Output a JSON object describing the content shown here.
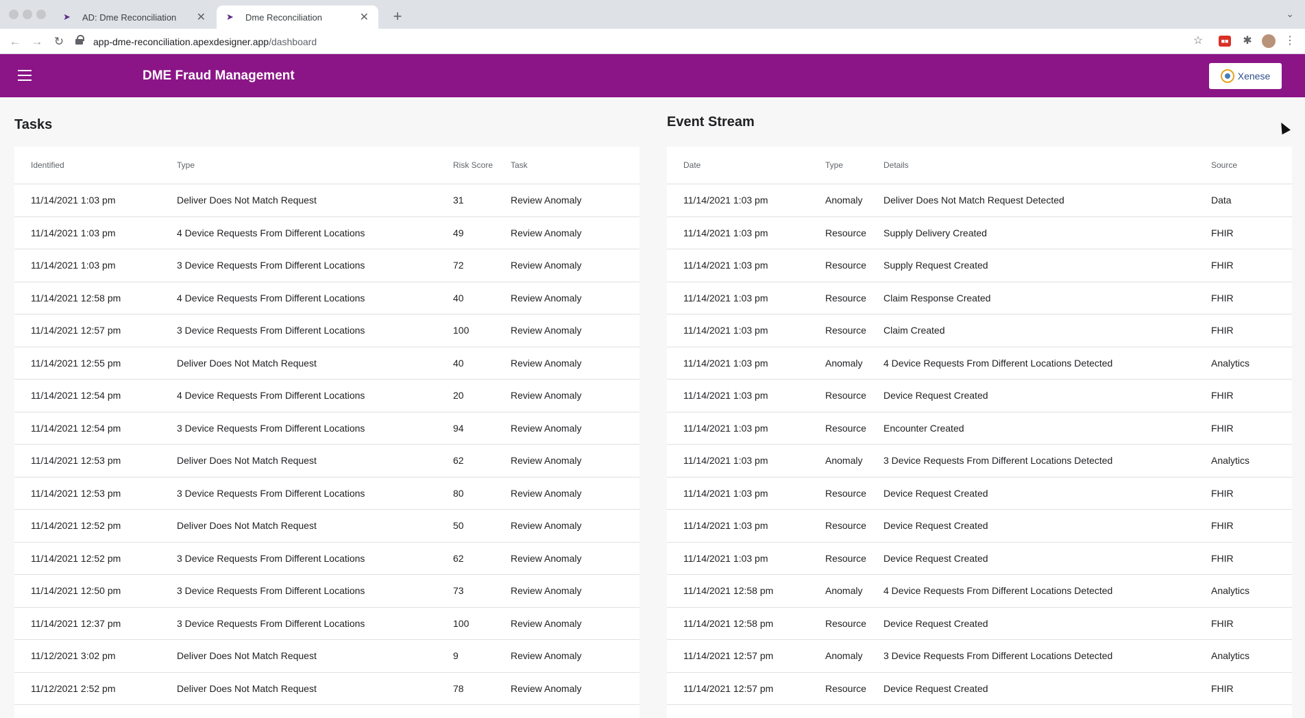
{
  "browser": {
    "tabs": [
      {
        "title": "AD: Dme Reconciliation",
        "icon": "apex-icon"
      },
      {
        "title": "Dme Reconciliation",
        "icon": "apex-icon"
      }
    ],
    "url_host": "app-dme-reconciliation.apexdesigner.app",
    "url_path": "/dashboard"
  },
  "app": {
    "title": "DME Fraud Management",
    "logo_text": "Xenese",
    "accent_color": "#8b1587"
  },
  "tasks": {
    "title": "Tasks",
    "columns": [
      "Identified",
      "Type",
      "Risk Score",
      "Task"
    ],
    "rows": [
      [
        "11/14/2021 1:03 pm",
        "Deliver Does Not Match Request",
        "31",
        "Review Anomaly"
      ],
      [
        "11/14/2021 1:03 pm",
        "4 Device Requests From Different Locations",
        "49",
        "Review Anomaly"
      ],
      [
        "11/14/2021 1:03 pm",
        "3 Device Requests From Different Locations",
        "72",
        "Review Anomaly"
      ],
      [
        "11/14/2021 12:58 pm",
        "4 Device Requests From Different Locations",
        "40",
        "Review Anomaly"
      ],
      [
        "11/14/2021 12:57 pm",
        "3 Device Requests From Different Locations",
        "100",
        "Review Anomaly"
      ],
      [
        "11/14/2021 12:55 pm",
        "Deliver Does Not Match Request",
        "40",
        "Review Anomaly"
      ],
      [
        "11/14/2021 12:54 pm",
        "4 Device Requests From Different Locations",
        "20",
        "Review Anomaly"
      ],
      [
        "11/14/2021 12:54 pm",
        "3 Device Requests From Different Locations",
        "94",
        "Review Anomaly"
      ],
      [
        "11/14/2021 12:53 pm",
        "Deliver Does Not Match Request",
        "62",
        "Review Anomaly"
      ],
      [
        "11/14/2021 12:53 pm",
        "3 Device Requests From Different Locations",
        "80",
        "Review Anomaly"
      ],
      [
        "11/14/2021 12:52 pm",
        "Deliver Does Not Match Request",
        "50",
        "Review Anomaly"
      ],
      [
        "11/14/2021 12:52 pm",
        "3 Device Requests From Different Locations",
        "62",
        "Review Anomaly"
      ],
      [
        "11/14/2021 12:50 pm",
        "3 Device Requests From Different Locations",
        "73",
        "Review Anomaly"
      ],
      [
        "11/14/2021 12:37 pm",
        "3 Device Requests From Different Locations",
        "100",
        "Review Anomaly"
      ],
      [
        "11/12/2021 3:02 pm",
        "Deliver Does Not Match Request",
        "9",
        "Review Anomaly"
      ],
      [
        "11/12/2021 2:52 pm",
        "Deliver Does Not Match Request",
        "78",
        "Review Anomaly"
      ]
    ]
  },
  "events": {
    "title": "Event Stream",
    "columns": [
      "Date",
      "Type",
      "Details",
      "Source"
    ],
    "rows": [
      [
        "11/14/2021 1:03 pm",
        "Anomaly",
        "Deliver Does Not Match Request Detected",
        "Data"
      ],
      [
        "11/14/2021 1:03 pm",
        "Resource",
        "Supply Delivery Created",
        "FHIR"
      ],
      [
        "11/14/2021 1:03 pm",
        "Resource",
        "Supply Request Created",
        "FHIR"
      ],
      [
        "11/14/2021 1:03 pm",
        "Resource",
        "Claim Response Created",
        "FHIR"
      ],
      [
        "11/14/2021 1:03 pm",
        "Resource",
        "Claim Created",
        "FHIR"
      ],
      [
        "11/14/2021 1:03 pm",
        "Anomaly",
        "4 Device Requests From Different Locations Detected",
        "Analytics"
      ],
      [
        "11/14/2021 1:03 pm",
        "Resource",
        "Device Request Created",
        "FHIR"
      ],
      [
        "11/14/2021 1:03 pm",
        "Resource",
        "Encounter Created",
        "FHIR"
      ],
      [
        "11/14/2021 1:03 pm",
        "Anomaly",
        "3 Device Requests From Different Locations Detected",
        "Analytics"
      ],
      [
        "11/14/2021 1:03 pm",
        "Resource",
        "Device Request Created",
        "FHIR"
      ],
      [
        "11/14/2021 1:03 pm",
        "Resource",
        "Device Request Created",
        "FHIR"
      ],
      [
        "11/14/2021 1:03 pm",
        "Resource",
        "Device Request Created",
        "FHIR"
      ],
      [
        "11/14/2021 12:58 pm",
        "Anomaly",
        "4 Device Requests From Different Locations Detected",
        "Analytics"
      ],
      [
        "11/14/2021 12:58 pm",
        "Resource",
        "Device Request Created",
        "FHIR"
      ],
      [
        "11/14/2021 12:57 pm",
        "Anomaly",
        "3 Device Requests From Different Locations Detected",
        "Analytics"
      ],
      [
        "11/14/2021 12:57 pm",
        "Resource",
        "Device Request Created",
        "FHIR"
      ]
    ]
  }
}
